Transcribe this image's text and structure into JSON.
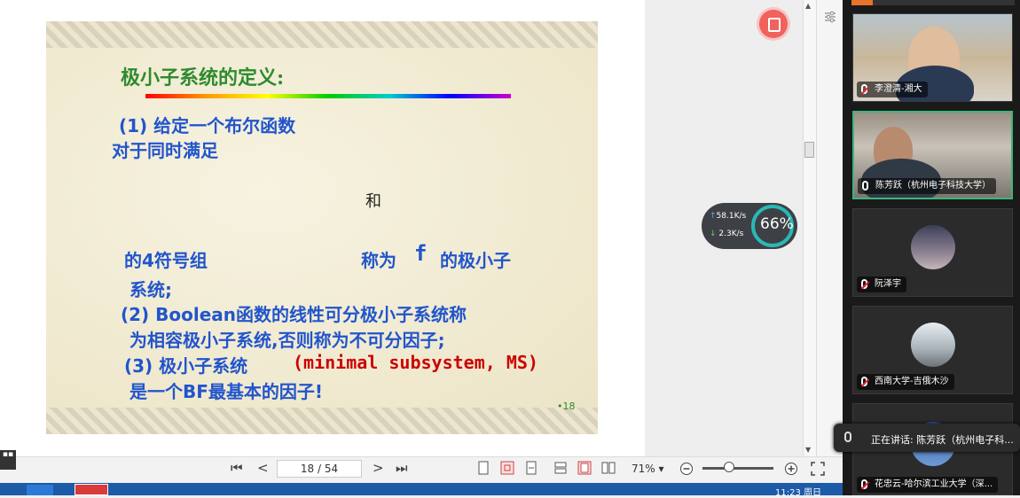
{
  "slide": {
    "title": "极小子系统的定义:",
    "line1": "(1) 给定一个布尔函数",
    "line2": "对于同时满足",
    "and_word": "和",
    "line3": "的4符号组",
    "line3b": "称为",
    "f_letter": "f",
    "line3c": "的极小子",
    "line4": "系统;",
    "line5": "(2) Boolean函数的线性可分极小子系统称",
    "line6": "为相容极小子系统,否则称为不可分因子;",
    "line7a": "(3) 极小子系统",
    "line7b": "(minimal subsystem, MS)",
    "line8": "是一个BF最基本的因子!",
    "page_mark": "•18"
  },
  "toolbar": {
    "page_input": "18 / 54",
    "zoom": "71%",
    "first_icon": "⏮",
    "prev_icon": "<",
    "next_icon": ">",
    "last_icon": "⏭"
  },
  "netmon": {
    "up": "58.1K/s",
    "down": "2.3K/s",
    "percent": "66%"
  },
  "taskbar": {
    "clock": "11:23 周日"
  },
  "participants": [
    {
      "name": "李澄清-湘大",
      "mic": "off"
    },
    {
      "name": "陈芳跃（杭州电子科技大学）",
      "mic": "on"
    },
    {
      "name": "阮泽宇",
      "mic": "off"
    },
    {
      "name": "西南大学-吉俄木沙",
      "mic": "off"
    },
    {
      "name": "花忠云-哈尔滨工业大学（深...",
      "mic": "off"
    }
  ],
  "speaking": {
    "text": "正在讲话: 陈芳跃（杭州电子科..."
  },
  "colors": {
    "title_green": "#2e8b2e",
    "text_blue": "#2255cc",
    "highlight_red": "#cc0000",
    "active_tile": "#3fb57a"
  }
}
